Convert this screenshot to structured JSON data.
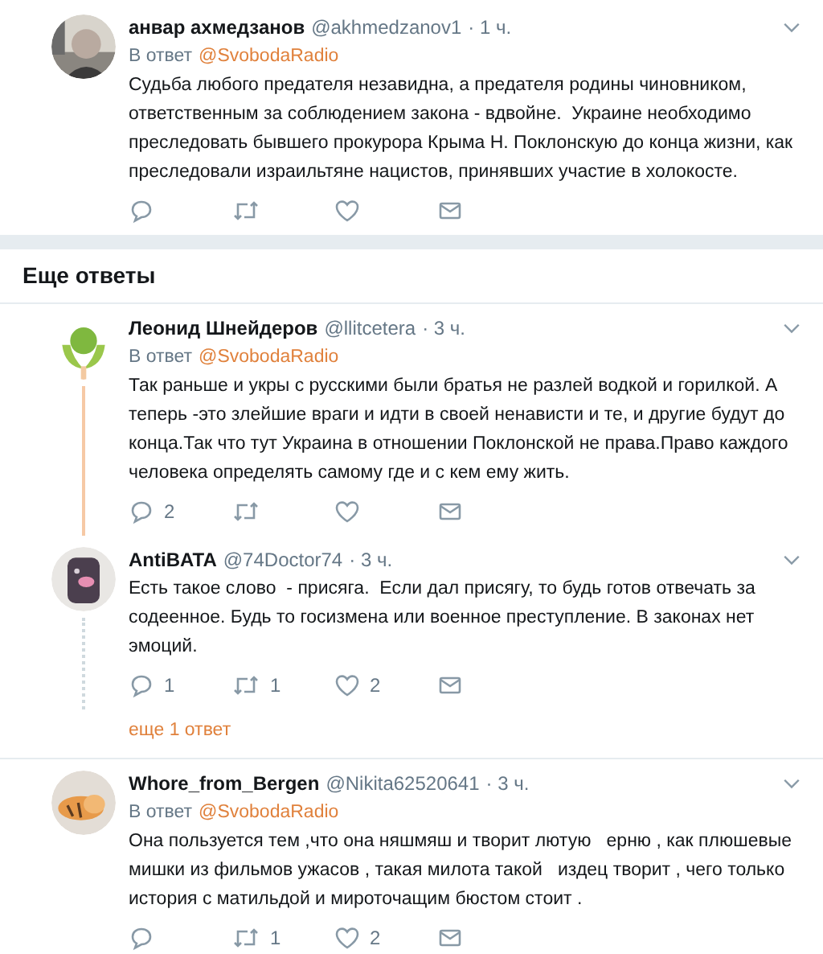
{
  "main_tweet": {
    "name": "анвар ахмедзанов",
    "handle": "@akhmedzanov1",
    "time": "· 1 ч.",
    "reply_label": "В ответ",
    "reply_to": "@SvobodaRadio",
    "text": "Судьба любого предателя незавидна, а предателя родины чиновником, ответственным за соблюдением закона - вдвойне.  Украине необходимо преследовать бывшего прокурора Крыма Н. Поклонскую до конца жизни, как преследовали израильтяне нацистов, принявших участие в холокосте."
  },
  "section_title": "Еще ответы",
  "threads": [
    {
      "tweets": [
        {
          "name": "Леонид Шнейдеров",
          "handle": "@llitcetera",
          "time": "· 3 ч.",
          "reply_label": "В ответ",
          "reply_to": "@SvobodaRadio",
          "text": "Так раньше и укры с русскими были братья не разлей водкой и горилкой. А теперь -это злейшие враги и идти в своей ненависти и те, и другие будут до конца.Так что тут Украина в отношении Поклонской не права.Право каждого человека определять самому где и с кем ему жить.",
          "actions": {
            "replies": "2"
          }
        },
        {
          "name": "AntiBATA",
          "handle": "@74Doctor74",
          "time": "· 3 ч.",
          "text": "Есть такое слово  - присяга.  Если дал присягу, то будь готов отвечать за содеенное. Будь то госизмена или военное преступление. В законах нет эмоций.",
          "actions": {
            "replies": "1",
            "retweets": "1",
            "likes": "2"
          }
        }
      ],
      "more_replies": "еще 1 ответ"
    },
    {
      "tweets": [
        {
          "name": "Whore_from_Bergen",
          "handle": "@Nikita62520641",
          "time": "· 3 ч.",
          "reply_label": "В ответ",
          "reply_to": "@SvobodaRadio",
          "text": "Она пользуется тем ,что она няшмяш и творит лютую   ерню , как плюшевые мишки из фильмов ужасов , такая милота такой   издец творит , чего только история с матильдой и мироточащим бюстом стоит .",
          "actions": {
            "retweets": "1",
            "likes": "2"
          }
        }
      ]
    }
  ]
}
